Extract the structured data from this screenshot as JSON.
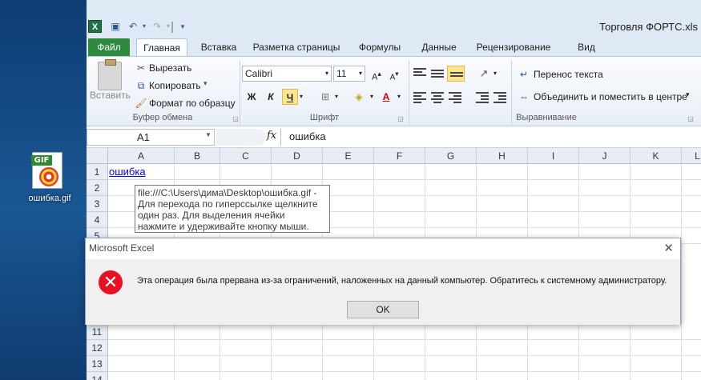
{
  "desktop": {
    "icon_badge": "GIF",
    "icon_label": "ошибка.gif"
  },
  "window": {
    "title": "Торговля ФОРТС.xls"
  },
  "tabs": {
    "file": "Файл",
    "items": [
      "Главная",
      "Вставка",
      "Разметка страницы",
      "Формулы",
      "Данные",
      "Рецензирование",
      "Вид"
    ]
  },
  "ribbon": {
    "clipboard": {
      "paste": "Вставить",
      "cut": "Вырезать",
      "copy": "Копировать",
      "format_painter": "Формат по образцу",
      "group": "Буфер обмена"
    },
    "font": {
      "name": "Calibri",
      "size": "11",
      "bold": "Ж",
      "italic": "К",
      "underline": "Ч",
      "group": "Шрифт"
    },
    "alignment": {
      "wrap": "Перенос текста",
      "merge": "Объединить и поместить в центре",
      "group": "Выравнивание"
    }
  },
  "formula_bar": {
    "name_box": "A1",
    "fx": "fx",
    "content": "ошибка"
  },
  "grid": {
    "columns": [
      "A",
      "B",
      "C",
      "D",
      "E",
      "F",
      "G",
      "H",
      "I",
      "J",
      "K",
      "L"
    ],
    "rows": [
      "1",
      "2",
      "3",
      "4",
      "5",
      "11",
      "12",
      "13",
      "14"
    ],
    "cell_a1": "ошибка"
  },
  "tooltip": {
    "lines": [
      "file:///C:\\Users\\дима\\Desktop\\ошибка.gif -",
      "Для перехода по гиперссылке щелкните",
      "один раз. Для выделения ячейки",
      "нажмите и удерживайте кнопку мыши."
    ]
  },
  "dialog": {
    "title": "Microsoft Excel",
    "close": "✕",
    "message": "Эта операция была прервана из-за ограничений, наложенных на данный компьютер. Обратитесь к системному администратору.",
    "ok": "OK"
  },
  "colors": {
    "accent": "#207245",
    "error": "#e81123",
    "link": "#0000ee"
  }
}
